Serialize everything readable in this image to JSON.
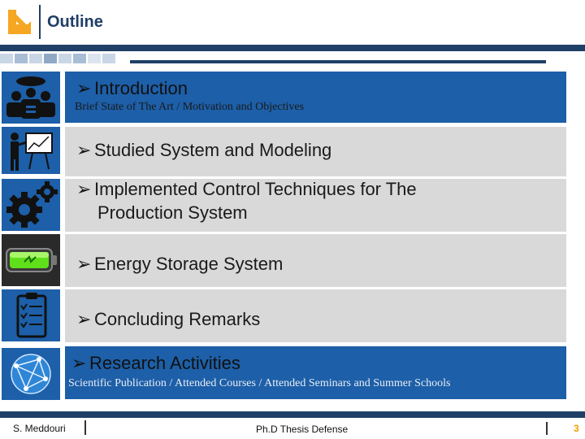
{
  "header": {
    "title": "Outline",
    "logo_icon": "polimi-logo-icon",
    "accent_color": "#f5a623",
    "brand_color": "#1f3f66"
  },
  "items": [
    {
      "icon": "presentation-meeting-icon",
      "label": "Introduction",
      "subtitle": "Brief State of The Art / Motivation and Objectives"
    },
    {
      "icon": "presenter-board-icon",
      "label": "Studied System and Modeling"
    },
    {
      "icon": "gears-icon",
      "label_line1": "Implemented Control Techniques for The",
      "label_line2": "Production System"
    },
    {
      "icon": "battery-icon",
      "label": "Energy Storage System"
    },
    {
      "icon": "checklist-icon",
      "label": "Concluding Remarks"
    },
    {
      "icon": "globe-network-icon",
      "label": "Research Activities",
      "subtitle": "Scientific Publication / Attended Courses / Attended Seminars and Summer Schools"
    }
  ],
  "footer": {
    "author": "S. Meddouri",
    "center": "Ph.D Thesis Defense",
    "page": "3"
  }
}
